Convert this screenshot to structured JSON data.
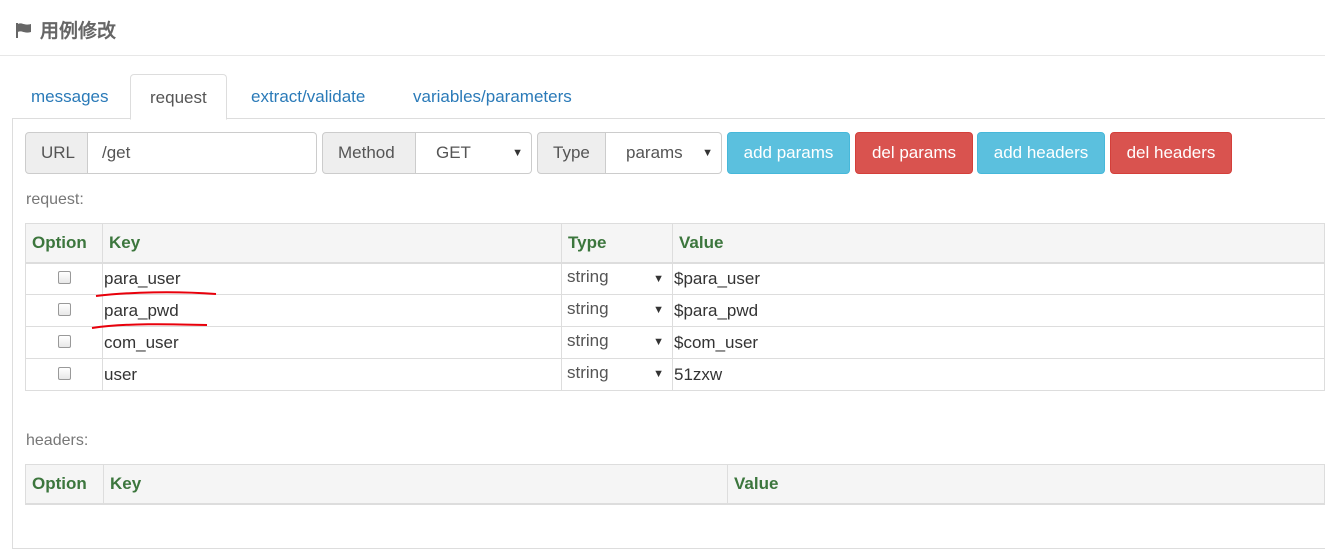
{
  "page": {
    "title": "用例修改",
    "flag_icon": "flag-icon"
  },
  "tabs": [
    {
      "label": "messages",
      "active": false
    },
    {
      "label": "request",
      "active": true
    },
    {
      "label": "extract/validate",
      "active": false
    },
    {
      "label": "variables/parameters",
      "active": false
    }
  ],
  "request_form": {
    "url_label": "URL",
    "url_value": "/get",
    "method_label": "Method",
    "method_value": "GET",
    "type_label": "Type",
    "type_value": "params",
    "buttons": {
      "add_params": "add params",
      "del_params": "del params",
      "add_headers": "add headers",
      "del_headers": "del headers"
    },
    "colors": {
      "info": "#5bc0de",
      "danger": "#d9534f",
      "header_text": "#3c763d",
      "link": "#2a7ab8",
      "annotation": "#e8000b"
    }
  },
  "request_table": {
    "label": "request:",
    "columns": [
      "Option",
      "Key",
      "Type",
      "Value"
    ],
    "rows": [
      {
        "key": "para_user",
        "type": "string",
        "value": "$para_user",
        "checked": false
      },
      {
        "key": "para_pwd",
        "type": "string",
        "value": "$para_pwd",
        "checked": false
      },
      {
        "key": "com_user",
        "type": "string",
        "value": "$com_user",
        "checked": false
      },
      {
        "key": "user",
        "type": "string",
        "value": "51zxw",
        "checked": false
      }
    ]
  },
  "headers_table": {
    "label": "headers:",
    "columns": [
      "Option",
      "Key",
      "Value"
    ]
  }
}
